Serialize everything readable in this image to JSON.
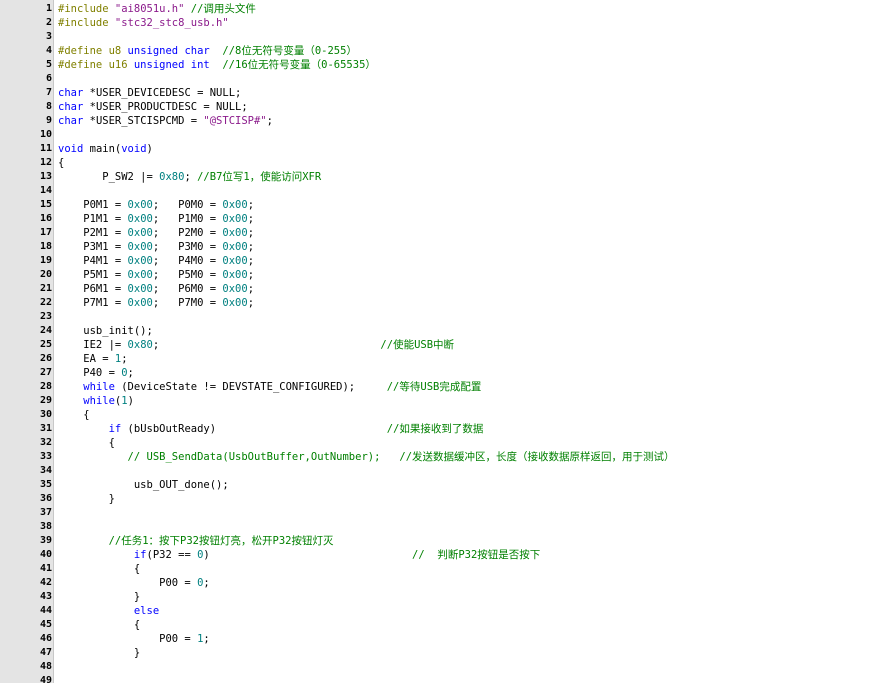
{
  "lines": [
    {
      "n": "1",
      "t": [
        [
          "pre",
          "#include "
        ],
        [
          "str",
          "\"ai8051u.h\""
        ],
        [
          "cmt",
          " //调用头文件"
        ]
      ]
    },
    {
      "n": "2",
      "t": [
        [
          "pre",
          "#include "
        ],
        [
          "str",
          "\"stc32_stc8_usb.h\""
        ]
      ]
    },
    {
      "n": "3",
      "t": []
    },
    {
      "n": "4",
      "t": [
        [
          "pre",
          "#define u8 "
        ],
        [
          "kw",
          "unsigned char"
        ],
        [
          "cmt",
          "  //8位无符号变量（0-255）"
        ]
      ]
    },
    {
      "n": "5",
      "t": [
        [
          "pre",
          "#define u16 "
        ],
        [
          "kw",
          "unsigned int"
        ],
        [
          "cmt",
          "  //16位无符号变量（0-65535）"
        ]
      ]
    },
    {
      "n": "6",
      "t": []
    },
    {
      "n": "7",
      "t": [
        [
          "kw",
          "char"
        ],
        [
          "txt",
          " *USER_DEVICEDESC = NULL;"
        ]
      ]
    },
    {
      "n": "8",
      "t": [
        [
          "kw",
          "char"
        ],
        [
          "txt",
          " *USER_PRODUCTDESC = NULL;"
        ]
      ]
    },
    {
      "n": "9",
      "t": [
        [
          "kw",
          "char"
        ],
        [
          "txt",
          " *USER_STCISPCMD = "
        ],
        [
          "str",
          "\"@STCISP#\""
        ],
        [
          "txt",
          ";"
        ]
      ]
    },
    {
      "n": "10",
      "t": []
    },
    {
      "n": "11",
      "t": [
        [
          "kw",
          "void"
        ],
        [
          "txt",
          " main("
        ],
        [
          "kw",
          "void"
        ],
        [
          "txt",
          ")"
        ]
      ]
    },
    {
      "n": "12",
      "t": [
        [
          "txt",
          "{"
        ]
      ]
    },
    {
      "n": "13",
      "t": [
        [
          "txt",
          "       P_SW2 |= "
        ],
        [
          "num",
          "0x80"
        ],
        [
          "txt",
          "; "
        ],
        [
          "cmt",
          "//B7位写1，使能访问XFR"
        ]
      ]
    },
    {
      "n": "14",
      "t": []
    },
    {
      "n": "15",
      "t": [
        [
          "txt",
          "    P0M1 = "
        ],
        [
          "num",
          "0x00"
        ],
        [
          "txt",
          ";   P0M0 = "
        ],
        [
          "num",
          "0x00"
        ],
        [
          "txt",
          ";"
        ]
      ]
    },
    {
      "n": "16",
      "t": [
        [
          "txt",
          "    P1M1 = "
        ],
        [
          "num",
          "0x00"
        ],
        [
          "txt",
          ";   P1M0 = "
        ],
        [
          "num",
          "0x00"
        ],
        [
          "txt",
          ";"
        ]
      ]
    },
    {
      "n": "17",
      "t": [
        [
          "txt",
          "    P2M1 = "
        ],
        [
          "num",
          "0x00"
        ],
        [
          "txt",
          ";   P2M0 = "
        ],
        [
          "num",
          "0x00"
        ],
        [
          "txt",
          ";"
        ]
      ]
    },
    {
      "n": "18",
      "t": [
        [
          "txt",
          "    P3M1 = "
        ],
        [
          "num",
          "0x00"
        ],
        [
          "txt",
          ";   P3M0 = "
        ],
        [
          "num",
          "0x00"
        ],
        [
          "txt",
          ";"
        ]
      ]
    },
    {
      "n": "19",
      "t": [
        [
          "txt",
          "    P4M1 = "
        ],
        [
          "num",
          "0x00"
        ],
        [
          "txt",
          ";   P4M0 = "
        ],
        [
          "num",
          "0x00"
        ],
        [
          "txt",
          ";"
        ]
      ]
    },
    {
      "n": "20",
      "t": [
        [
          "txt",
          "    P5M1 = "
        ],
        [
          "num",
          "0x00"
        ],
        [
          "txt",
          ";   P5M0 = "
        ],
        [
          "num",
          "0x00"
        ],
        [
          "txt",
          ";"
        ]
      ]
    },
    {
      "n": "21",
      "t": [
        [
          "txt",
          "    P6M1 = "
        ],
        [
          "num",
          "0x00"
        ],
        [
          "txt",
          ";   P6M0 = "
        ],
        [
          "num",
          "0x00"
        ],
        [
          "txt",
          ";"
        ]
      ]
    },
    {
      "n": "22",
      "t": [
        [
          "txt",
          "    P7M1 = "
        ],
        [
          "num",
          "0x00"
        ],
        [
          "txt",
          ";   P7M0 = "
        ],
        [
          "num",
          "0x00"
        ],
        [
          "txt",
          ";"
        ]
      ]
    },
    {
      "n": "23",
      "t": []
    },
    {
      "n": "24",
      "t": [
        [
          "txt",
          "    usb_init();"
        ]
      ]
    },
    {
      "n": "25",
      "t": [
        [
          "txt",
          "    IE2 |= "
        ],
        [
          "num",
          "0x80"
        ],
        [
          "txt",
          ";                                   "
        ],
        [
          "cmt",
          "//使能USB中断"
        ]
      ]
    },
    {
      "n": "26",
      "t": [
        [
          "txt",
          "    EA = "
        ],
        [
          "num",
          "1"
        ],
        [
          "txt",
          ";"
        ]
      ]
    },
    {
      "n": "27",
      "t": [
        [
          "txt",
          "    P40 = "
        ],
        [
          "num",
          "0"
        ],
        [
          "txt",
          ";"
        ]
      ]
    },
    {
      "n": "28",
      "t": [
        [
          "txt",
          "    "
        ],
        [
          "kw",
          "while"
        ],
        [
          "txt",
          " (DeviceState != DEVSTATE_CONFIGURED);     "
        ],
        [
          "cmt",
          "//等待USB完成配置"
        ]
      ]
    },
    {
      "n": "29",
      "t": [
        [
          "txt",
          "    "
        ],
        [
          "kw",
          "while"
        ],
        [
          "txt",
          "("
        ],
        [
          "num",
          "1"
        ],
        [
          "txt",
          ")"
        ]
      ]
    },
    {
      "n": "30",
      "t": [
        [
          "txt",
          "    {"
        ]
      ]
    },
    {
      "n": "31",
      "t": [
        [
          "txt",
          "        "
        ],
        [
          "kw",
          "if"
        ],
        [
          "txt",
          " (bUsbOutReady)                           "
        ],
        [
          "cmt",
          "//如果接收到了数据"
        ]
      ]
    },
    {
      "n": "32",
      "t": [
        [
          "txt",
          "        {"
        ]
      ]
    },
    {
      "n": "33",
      "t": [
        [
          "txt",
          "           "
        ],
        [
          "cmt",
          "// USB_SendData(UsbOutBuffer,OutNumber);   //发送数据缓冲区，长度（接收数据原样返回，用于测试）"
        ]
      ]
    },
    {
      "n": "34",
      "t": []
    },
    {
      "n": "35",
      "t": [
        [
          "txt",
          "            usb_OUT_done();"
        ]
      ]
    },
    {
      "n": "36",
      "t": [
        [
          "txt",
          "        }"
        ]
      ]
    },
    {
      "n": "37",
      "t": []
    },
    {
      "n": "38",
      "t": []
    },
    {
      "n": "39",
      "t": [
        [
          "txt",
          "        "
        ],
        [
          "cmt",
          "//任务1：按下P32按钮灯亮，松开P32按钮灯灭"
        ]
      ]
    },
    {
      "n": "40",
      "t": [
        [
          "txt",
          "            "
        ],
        [
          "kw",
          "if"
        ],
        [
          "txt",
          "(P32 == "
        ],
        [
          "num",
          "0"
        ],
        [
          "txt",
          ")                                "
        ],
        [
          "cmt",
          "//  判断P32按钮是否按下"
        ]
      ]
    },
    {
      "n": "41",
      "t": [
        [
          "txt",
          "            {"
        ]
      ]
    },
    {
      "n": "42",
      "t": [
        [
          "txt",
          "                P00 = "
        ],
        [
          "num",
          "0"
        ],
        [
          "txt",
          ";"
        ]
      ]
    },
    {
      "n": "43",
      "t": [
        [
          "txt",
          "            }"
        ]
      ]
    },
    {
      "n": "44",
      "t": [
        [
          "txt",
          "            "
        ],
        [
          "kw",
          "else"
        ]
      ]
    },
    {
      "n": "45",
      "t": [
        [
          "txt",
          "            {"
        ]
      ]
    },
    {
      "n": "46",
      "t": [
        [
          "txt",
          "                P00 = "
        ],
        [
          "num",
          "1"
        ],
        [
          "txt",
          ";"
        ]
      ]
    },
    {
      "n": "47",
      "t": [
        [
          "txt",
          "            }"
        ]
      ]
    },
    {
      "n": "48",
      "t": []
    },
    {
      "n": "49",
      "t": []
    }
  ]
}
